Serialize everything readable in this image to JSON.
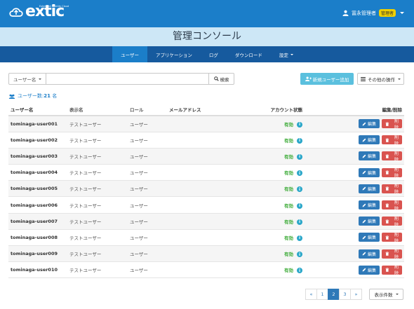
{
  "header": {
    "logo_text": "extic",
    "logo_tagline": "Extended Identity Cloud",
    "user_name": "冨永管理者",
    "admin_badge": "管理者"
  },
  "console_title": "管理コンソール",
  "nav": {
    "items": [
      {
        "label": "ユーザー",
        "active": true
      },
      {
        "label": "アプリケーション"
      },
      {
        "label": "ログ"
      },
      {
        "label": "ダウンロード"
      },
      {
        "label": "設定",
        "dropdown": true
      }
    ]
  },
  "toolbar": {
    "search_field_select": "ユーザー名",
    "search_value": "",
    "search_button": "検索",
    "new_user_button": "新規ユーザー追加",
    "other_ops_button": "その他の操作"
  },
  "user_count": {
    "prefix": "ユーザー数:",
    "count": "21",
    "suffix": " 名"
  },
  "table": {
    "headers": {
      "name": "ユーザー名",
      "display": "表示名",
      "role": "ロール",
      "mail": "メールアドレス",
      "status": "アカウント状態",
      "actions": "編集/削除"
    },
    "edit_label": "編集",
    "delete_label": "削除",
    "rows": [
      {
        "name": "tominaga-user001",
        "display": "テストユーザー",
        "role": "ユーザー",
        "mail": "",
        "status": "有効"
      },
      {
        "name": "tominaga-user002",
        "display": "テストユーザー",
        "role": "ユーザー",
        "mail": "",
        "status": "有効"
      },
      {
        "name": "tominaga-user003",
        "display": "テストユーザー",
        "role": "ユーザー",
        "mail": "",
        "status": "有効"
      },
      {
        "name": "tominaga-user004",
        "display": "テストユーザー",
        "role": "ユーザー",
        "mail": "",
        "status": "有効"
      },
      {
        "name": "tominaga-user005",
        "display": "テストユーザー",
        "role": "ユーザー",
        "mail": "",
        "status": "有効"
      },
      {
        "name": "tominaga-user006",
        "display": "テストユーザー",
        "role": "ユーザー",
        "mail": "",
        "status": "有効"
      },
      {
        "name": "tominaga-user007",
        "display": "テストユーザー",
        "role": "ユーザー",
        "mail": "",
        "status": "有効"
      },
      {
        "name": "tominaga-user008",
        "display": "テストユーザー",
        "role": "ユーザー",
        "mail": "",
        "status": "有効"
      },
      {
        "name": "tominaga-user009",
        "display": "テストユーザー",
        "role": "ユーザー",
        "mail": "",
        "status": "有効"
      },
      {
        "name": "tominaga-user010",
        "display": "テストユーザー",
        "role": "ユーザー",
        "mail": "",
        "status": "有効"
      }
    ]
  },
  "pagination": {
    "first": "«",
    "pages": [
      "1",
      "2",
      "3"
    ],
    "current": "2",
    "last": "»",
    "per_page_label": "表示件数"
  },
  "colors": {
    "header_blue": "#1b7ec9",
    "nav_dark": "#165a9e",
    "title_band": "#cde7f6",
    "status_green": "#3aaa35",
    "edit_blue": "#2f79b8",
    "delete_red": "#d9534f",
    "new_user_cyan": "#5bc0de"
  },
  "icons": {
    "logo": "cloud-icon",
    "user": "user-icon",
    "search": "search-icon",
    "add_user": "user-plus-icon",
    "menu": "list-icon",
    "users": "users-icon",
    "info": "info-icon",
    "edit": "pencil-icon",
    "delete": "trash-icon"
  }
}
